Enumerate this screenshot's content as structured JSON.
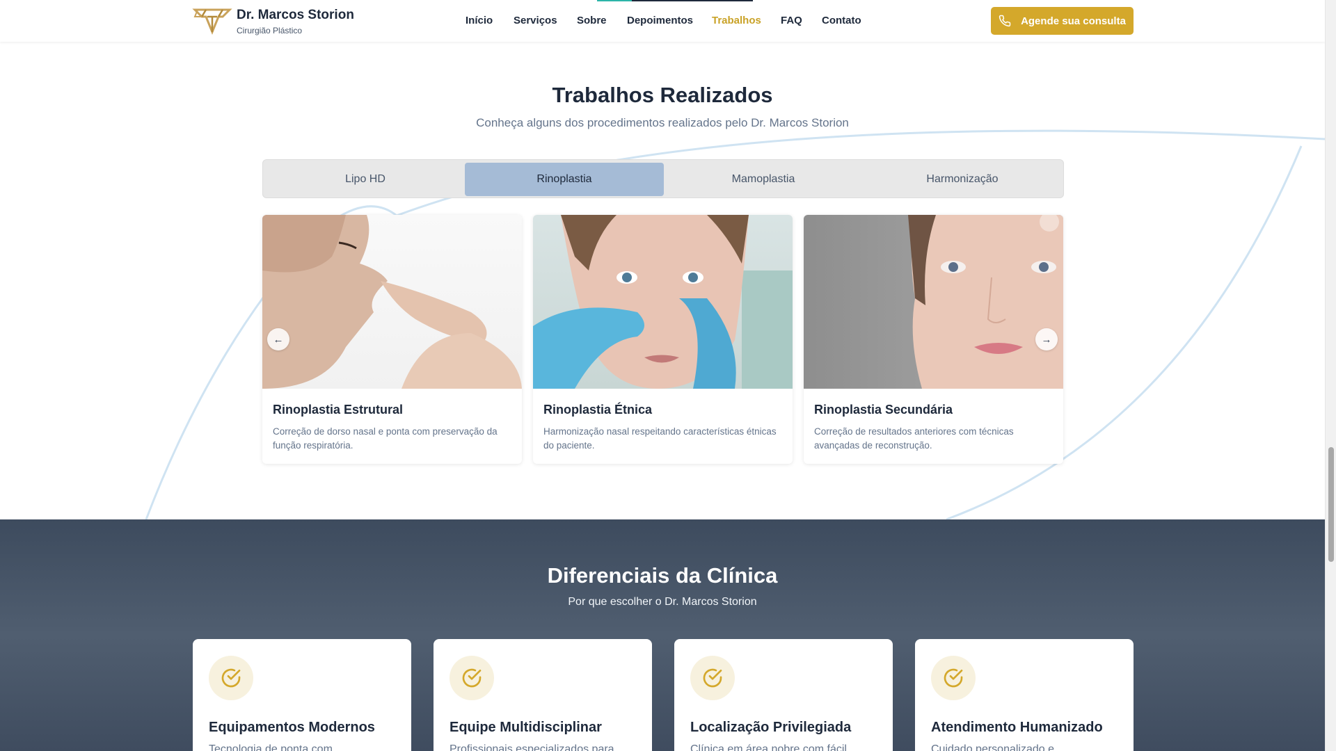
{
  "header": {
    "brand_name": "Dr. Marcos Storion",
    "brand_sub": "Cirurgião Plástico",
    "logo_icon": "ms-monogram-logo",
    "nav": [
      "Início",
      "Serviços",
      "Sobre",
      "Depoimentos",
      "Trabalhos",
      "FAQ",
      "Contato"
    ],
    "active_nav": "Trabalhos",
    "cta_label": "Agende sua consulta",
    "cta_icon": "phone-icon",
    "accent": "#d4a82b"
  },
  "work": {
    "title": "Trabalhos Realizados",
    "subtitle": "Conheça alguns dos procedimentos realizados pelo Dr. Marcos Storion",
    "tabs": [
      "Lipo HD",
      "Rinoplastia",
      "Mamoplastia",
      "Harmonização"
    ],
    "active_tab": "Rinoplastia",
    "cards": [
      {
        "title": "Rinoplastia Estrutural",
        "desc": "Correção de dorso nasal e ponta com preservação da função respiratória."
      },
      {
        "title": "Rinoplastia Étnica",
        "desc": "Harmonização nasal respeitando características étnicas do paciente."
      },
      {
        "title": "Rinoplastia Secundária",
        "desc": "Correção de resultados anteriores com técnicas avançadas de reconstrução."
      }
    ],
    "prev_icon": "arrow-left-icon",
    "next_icon": "arrow-right-icon"
  },
  "diferenciais": {
    "title": "Diferenciais da Clínica",
    "subtitle": "Por que escolher o Dr. Marcos Storion",
    "items": [
      {
        "title": "Equipamentos Modernos",
        "desc": "Tecnologia de ponta com",
        "icon": "check-circle-icon"
      },
      {
        "title": "Equipe Multidisciplinar",
        "desc": "Profissionais especializados para",
        "icon": "check-circle-icon"
      },
      {
        "title": "Localização Privilegiada",
        "desc": "Clínica em área nobre com fácil",
        "icon": "check-circle-icon"
      },
      {
        "title": "Atendimento Humanizado",
        "desc": "Cuidado personalizado e",
        "icon": "check-circle-icon"
      }
    ]
  }
}
